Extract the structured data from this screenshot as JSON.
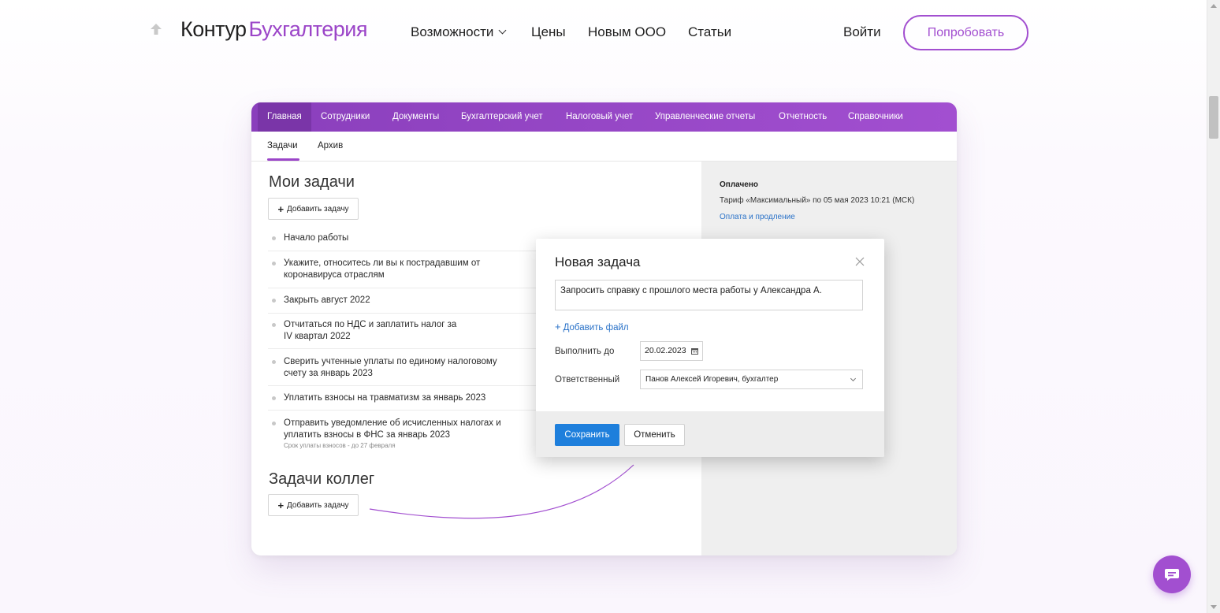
{
  "header": {
    "logo_main": "Контур",
    "logo_accent": "Бухгалтерия",
    "nav": [
      "Возможности",
      "Цены",
      "Новым ООО",
      "Статьи"
    ],
    "login": "Войти",
    "try_button": "Попробовать"
  },
  "app": {
    "tabs": [
      "Главная",
      "Сотрудники",
      "Документы",
      "Бухгалтерский учет",
      "Налоговый учет",
      "Управленческие отчеты",
      "Отчетность",
      "Справочники"
    ],
    "subtabs": [
      "Задачи",
      "Архив"
    ],
    "my_tasks_title": "Мои задачи",
    "colleague_tasks_title": "Задачи коллег",
    "add_task_label": "Добавить задачу",
    "tasks": [
      {
        "text": "Начало работы"
      },
      {
        "text": "Укажите, относитесь ли вы к пострадавшим от коронавируса отраслям"
      },
      {
        "text": "Закрыть август 2022"
      },
      {
        "text": "Отчитаться по НДС и заплатить налог за IV квартал 2022"
      },
      {
        "text": "Сверить учтенные уплаты по единому налоговому счету за январь 2023"
      },
      {
        "text": "Уплатить взносы на травматизм за январь 2023"
      },
      {
        "text": "Отправить уведомление об исчисленных налогах и уплатить взносы в ФНС за январь 2023",
        "note": "Срок уплаты взносов - до 27 февраля"
      }
    ],
    "payment": {
      "title": "Оплачено",
      "tariff": "Тариф «Максимальный» по 05 мая 2023 10:21 (МСК)",
      "link": "Оплата и продление"
    }
  },
  "modal": {
    "title": "Новая задача",
    "task_text": "Запросить справку с прошлого места работы у Александра А.",
    "add_file": "Добавить файл",
    "due_label": "Выполнить до",
    "due_value": "20.02.2023",
    "responsible_label": "Ответственный",
    "responsible_value": "Панов Алексей Игоревич, бухгалтер",
    "save": "Сохранить",
    "cancel": "Отменить"
  },
  "colors": {
    "accent": "#a24fd0",
    "app_header": "#8a3fbc",
    "primary_button": "#1e7fdc",
    "link": "#2a72c8"
  },
  "icons": [
    "arrow-up-icon",
    "chevron-down-icon",
    "close-icon",
    "calendar-icon",
    "plus-icon",
    "chat-icon"
  ]
}
